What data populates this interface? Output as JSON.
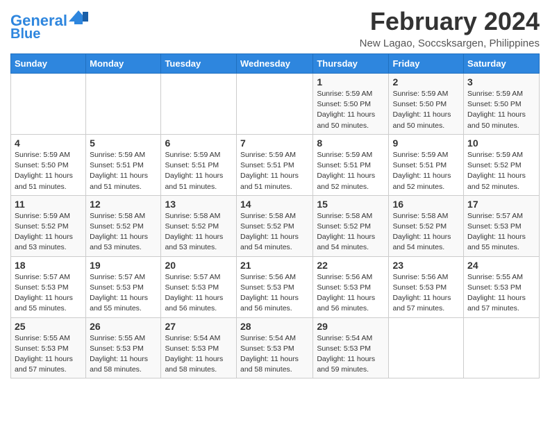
{
  "logo": {
    "line1": "General",
    "line2": "Blue"
  },
  "title": "February 2024",
  "location": "New Lagao, Soccsksargen, Philippines",
  "days_of_week": [
    "Sunday",
    "Monday",
    "Tuesday",
    "Wednesday",
    "Thursday",
    "Friday",
    "Saturday"
  ],
  "weeks": [
    [
      {
        "day": "",
        "info": ""
      },
      {
        "day": "",
        "info": ""
      },
      {
        "day": "",
        "info": ""
      },
      {
        "day": "",
        "info": ""
      },
      {
        "day": "1",
        "info": "Sunrise: 5:59 AM\nSunset: 5:50 PM\nDaylight: 11 hours\nand 50 minutes."
      },
      {
        "day": "2",
        "info": "Sunrise: 5:59 AM\nSunset: 5:50 PM\nDaylight: 11 hours\nand 50 minutes."
      },
      {
        "day": "3",
        "info": "Sunrise: 5:59 AM\nSunset: 5:50 PM\nDaylight: 11 hours\nand 50 minutes."
      }
    ],
    [
      {
        "day": "4",
        "info": "Sunrise: 5:59 AM\nSunset: 5:50 PM\nDaylight: 11 hours\nand 51 minutes."
      },
      {
        "day": "5",
        "info": "Sunrise: 5:59 AM\nSunset: 5:51 PM\nDaylight: 11 hours\nand 51 minutes."
      },
      {
        "day": "6",
        "info": "Sunrise: 5:59 AM\nSunset: 5:51 PM\nDaylight: 11 hours\nand 51 minutes."
      },
      {
        "day": "7",
        "info": "Sunrise: 5:59 AM\nSunset: 5:51 PM\nDaylight: 11 hours\nand 51 minutes."
      },
      {
        "day": "8",
        "info": "Sunrise: 5:59 AM\nSunset: 5:51 PM\nDaylight: 11 hours\nand 52 minutes."
      },
      {
        "day": "9",
        "info": "Sunrise: 5:59 AM\nSunset: 5:51 PM\nDaylight: 11 hours\nand 52 minutes."
      },
      {
        "day": "10",
        "info": "Sunrise: 5:59 AM\nSunset: 5:52 PM\nDaylight: 11 hours\nand 52 minutes."
      }
    ],
    [
      {
        "day": "11",
        "info": "Sunrise: 5:59 AM\nSunset: 5:52 PM\nDaylight: 11 hours\nand 53 minutes."
      },
      {
        "day": "12",
        "info": "Sunrise: 5:58 AM\nSunset: 5:52 PM\nDaylight: 11 hours\nand 53 minutes."
      },
      {
        "day": "13",
        "info": "Sunrise: 5:58 AM\nSunset: 5:52 PM\nDaylight: 11 hours\nand 53 minutes."
      },
      {
        "day": "14",
        "info": "Sunrise: 5:58 AM\nSunset: 5:52 PM\nDaylight: 11 hours\nand 54 minutes."
      },
      {
        "day": "15",
        "info": "Sunrise: 5:58 AM\nSunset: 5:52 PM\nDaylight: 11 hours\nand 54 minutes."
      },
      {
        "day": "16",
        "info": "Sunrise: 5:58 AM\nSunset: 5:52 PM\nDaylight: 11 hours\nand 54 minutes."
      },
      {
        "day": "17",
        "info": "Sunrise: 5:57 AM\nSunset: 5:53 PM\nDaylight: 11 hours\nand 55 minutes."
      }
    ],
    [
      {
        "day": "18",
        "info": "Sunrise: 5:57 AM\nSunset: 5:53 PM\nDaylight: 11 hours\nand 55 minutes."
      },
      {
        "day": "19",
        "info": "Sunrise: 5:57 AM\nSunset: 5:53 PM\nDaylight: 11 hours\nand 55 minutes."
      },
      {
        "day": "20",
        "info": "Sunrise: 5:57 AM\nSunset: 5:53 PM\nDaylight: 11 hours\nand 56 minutes."
      },
      {
        "day": "21",
        "info": "Sunrise: 5:56 AM\nSunset: 5:53 PM\nDaylight: 11 hours\nand 56 minutes."
      },
      {
        "day": "22",
        "info": "Sunrise: 5:56 AM\nSunset: 5:53 PM\nDaylight: 11 hours\nand 56 minutes."
      },
      {
        "day": "23",
        "info": "Sunrise: 5:56 AM\nSunset: 5:53 PM\nDaylight: 11 hours\nand 57 minutes."
      },
      {
        "day": "24",
        "info": "Sunrise: 5:55 AM\nSunset: 5:53 PM\nDaylight: 11 hours\nand 57 minutes."
      }
    ],
    [
      {
        "day": "25",
        "info": "Sunrise: 5:55 AM\nSunset: 5:53 PM\nDaylight: 11 hours\nand 57 minutes."
      },
      {
        "day": "26",
        "info": "Sunrise: 5:55 AM\nSunset: 5:53 PM\nDaylight: 11 hours\nand 58 minutes."
      },
      {
        "day": "27",
        "info": "Sunrise: 5:54 AM\nSunset: 5:53 PM\nDaylight: 11 hours\nand 58 minutes."
      },
      {
        "day": "28",
        "info": "Sunrise: 5:54 AM\nSunset: 5:53 PM\nDaylight: 11 hours\nand 58 minutes."
      },
      {
        "day": "29",
        "info": "Sunrise: 5:54 AM\nSunset: 5:53 PM\nDaylight: 11 hours\nand 59 minutes."
      },
      {
        "day": "",
        "info": ""
      },
      {
        "day": "",
        "info": ""
      }
    ]
  ]
}
